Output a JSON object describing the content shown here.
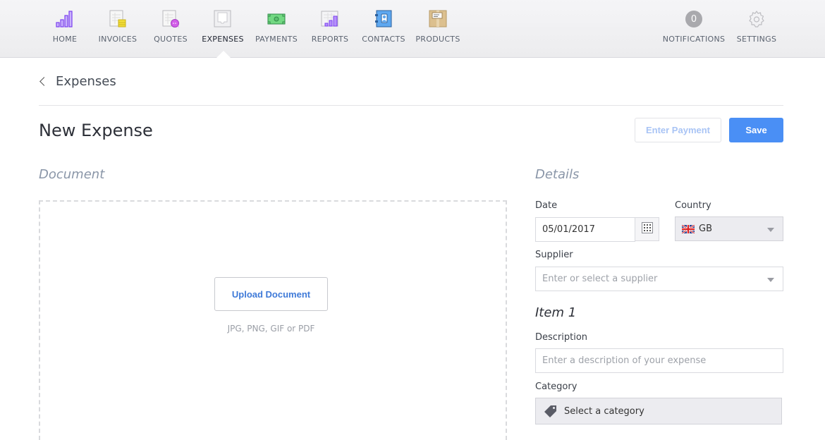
{
  "nav": {
    "items": [
      {
        "id": "home",
        "label": "HOME",
        "icon": "bar-chart-icon"
      },
      {
        "id": "invoices",
        "label": "INVOICES",
        "icon": "invoice-icon"
      },
      {
        "id": "quotes",
        "label": "QUOTES",
        "icon": "quote-icon"
      },
      {
        "id": "expenses",
        "label": "EXPENSES",
        "icon": "inbox-tray-icon",
        "active": true
      },
      {
        "id": "payments",
        "label": "PAYMENTS",
        "icon": "banknote-icon"
      },
      {
        "id": "reports",
        "label": "REPORTS",
        "icon": "report-chart-icon"
      },
      {
        "id": "contacts",
        "label": "CONTACTS",
        "icon": "address-book-icon"
      },
      {
        "id": "products",
        "label": "PRODUCTS",
        "icon": "package-box-icon"
      }
    ],
    "notifications": {
      "label": "NOTIFICATIONS",
      "count": "0"
    },
    "settings": {
      "label": "SETTINGS"
    }
  },
  "breadcrumb": {
    "back_label": "Expenses"
  },
  "page": {
    "title": "New Expense",
    "enter_payment_label": "Enter Payment",
    "save_label": "Save"
  },
  "document": {
    "heading": "Document",
    "upload_label": "Upload Document",
    "hint": "JPG, PNG, GIF or PDF"
  },
  "details": {
    "heading": "Details",
    "date": {
      "label": "Date",
      "value": "05/01/2017"
    },
    "country": {
      "label": "Country",
      "value": "GB",
      "flag": "uk-flag"
    },
    "supplier": {
      "label": "Supplier",
      "placeholder": "Enter or select a supplier"
    },
    "item_heading": "Item 1",
    "description": {
      "label": "Description",
      "placeholder": "Enter a description of your expense"
    },
    "category": {
      "label": "Category",
      "placeholder": "Select a category"
    }
  },
  "colors": {
    "accent": "#4a8ff5",
    "link": "#3f7ad8",
    "muted_heading": "#8a96a8"
  }
}
